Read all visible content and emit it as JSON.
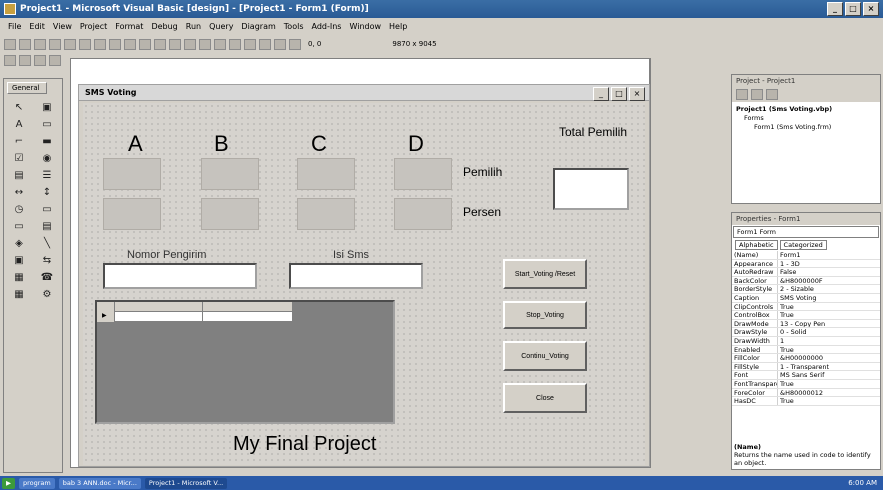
{
  "window": {
    "title": "Project1 - Microsoft Visual Basic [design] - [Project1 - Form1 (Form)]"
  },
  "menu": [
    "File",
    "Edit",
    "View",
    "Project",
    "Format",
    "Debug",
    "Run",
    "Query",
    "Diagram",
    "Tools",
    "Add-Ins",
    "Window",
    "Help"
  ],
  "toolbar": {
    "position": "0, 0",
    "size": "9870 x 9045"
  },
  "toolbox": {
    "title": "General"
  },
  "form": {
    "title": "SMS Voting",
    "letters": [
      "A",
      "B",
      "C",
      "D"
    ],
    "total_label": "Total Pemilih",
    "pemilih_label": "Pemilih",
    "persen_label": "Persen",
    "nomor_label": "Nomor Pengirim",
    "isi_label": "Isi Sms",
    "buttons": {
      "start": "Start_Voting /Reset",
      "stop": "Stop_Voting",
      "continue": "Continu_Voting",
      "close": "Close"
    },
    "footer": "My Final Project"
  },
  "project_pane": {
    "title": "Project - Project1",
    "tree": [
      "Project1 (Sms Voting.vbp)",
      "Forms",
      "Form1 (Sms Voting.frm)"
    ]
  },
  "props_pane": {
    "title": "Properties - Form1",
    "object": "Form1  Form",
    "tabs": [
      "Alphabetic",
      "Categorized"
    ],
    "rows": [
      [
        "(Name)",
        "Form1"
      ],
      [
        "Appearance",
        "1 - 3D"
      ],
      [
        "AutoRedraw",
        "False"
      ],
      [
        "BackColor",
        "&H8000000F"
      ],
      [
        "BorderStyle",
        "2 - Sizable"
      ],
      [
        "Caption",
        "SMS Voting"
      ],
      [
        "ClipControls",
        "True"
      ],
      [
        "ControlBox",
        "True"
      ],
      [
        "DrawMode",
        "13 - Copy Pen"
      ],
      [
        "DrawStyle",
        "0 - Solid"
      ],
      [
        "DrawWidth",
        "1"
      ],
      [
        "Enabled",
        "True"
      ],
      [
        "FillColor",
        "&H00000000"
      ],
      [
        "FillStyle",
        "1 - Transparent"
      ],
      [
        "Font",
        "MS Sans Serif"
      ],
      [
        "FontTransparent",
        "True"
      ],
      [
        "ForeColor",
        "&H80000012"
      ],
      [
        "HasDC",
        "True"
      ]
    ],
    "desc_title": "(Name)",
    "desc": "Returns the name used in code to identify an object."
  },
  "taskbar": [
    "program",
    "bab 3 ANN.doc - Micr...",
    "Project1 - Microsoft V..."
  ],
  "clock": "6:00 AM"
}
